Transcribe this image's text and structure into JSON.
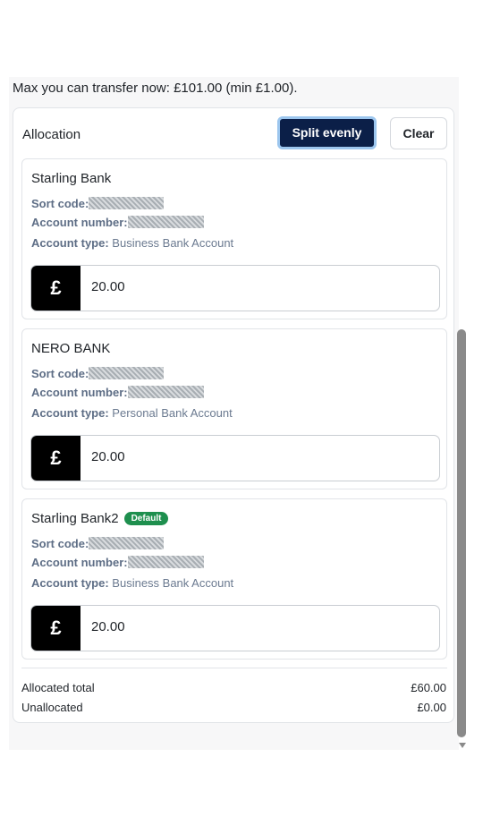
{
  "transfer": {
    "max_text": "Max you can transfer now: £101.00 (min £1.00)."
  },
  "allocation": {
    "title": "Allocation",
    "split_label": "Split evenly",
    "clear_label": "Clear"
  },
  "labels": {
    "sort_code": "Sort code:",
    "account_number": "Account number:",
    "account_type": "Account type:",
    "currency_symbol": "£"
  },
  "accounts": [
    {
      "name": "Starling Bank",
      "account_type": "Business Bank Account",
      "amount": "20.00",
      "badge": ""
    },
    {
      "name": "NERO BANK",
      "account_type": "Personal Bank Account",
      "amount": "20.00",
      "badge": ""
    },
    {
      "name": "Starling Bank2",
      "account_type": "Business Bank Account",
      "amount": "20.00",
      "badge": "Default"
    }
  ],
  "totals": {
    "allocated_label": "Allocated total",
    "allocated_value": "£60.00",
    "unallocated_label": "Unallocated",
    "unallocated_value": "£0.00"
  },
  "colors": {
    "split_button_bg": "#0b1f48",
    "default_badge": "#1e8f4e",
    "currency_block": "#000000"
  }
}
